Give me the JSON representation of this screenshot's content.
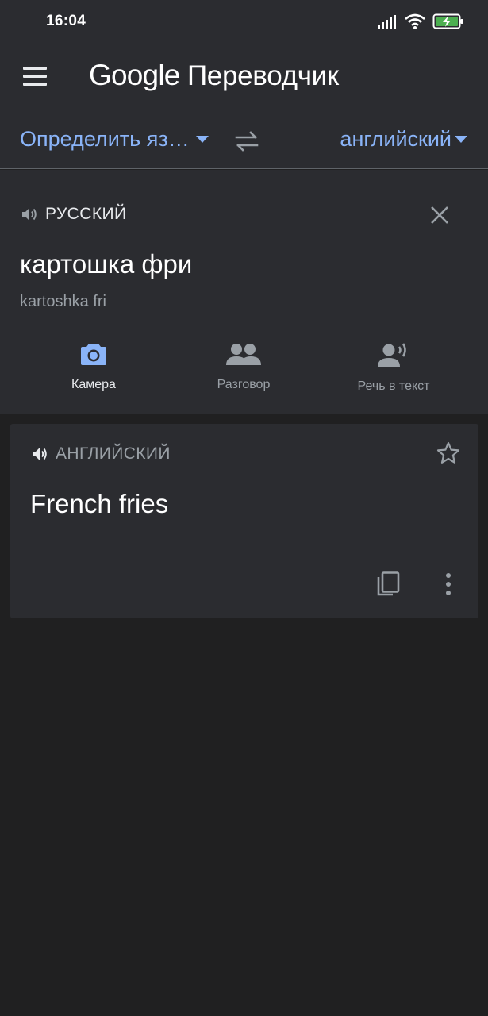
{
  "status_bar": {
    "time": "16:04",
    "icons": [
      "signal-icon",
      "wifi-icon",
      "battery-charging-icon"
    ]
  },
  "app_bar": {
    "menu_icon": "menu-icon",
    "title_brand": "Google",
    "title_product": "Переводчик"
  },
  "language_bar": {
    "source_language": "Определить яз…",
    "target_language": "английский",
    "swap_icon": "swap-icon"
  },
  "source": {
    "language_label": "РУССКИЙ",
    "text": "картошка фри",
    "transliteration": "kartoshka fri",
    "tools": [
      {
        "label": "Камера",
        "icon": "camera-icon",
        "active": true
      },
      {
        "label": "Разговор",
        "icon": "conversation-icon",
        "active": false
      },
      {
        "label": "Речь в текст",
        "icon": "speech-to-text-icon",
        "active": false
      }
    ]
  },
  "result": {
    "language_label": "АНГЛИЙСКИЙ",
    "text": "French fries",
    "actions": [
      "star-icon",
      "copy-icon",
      "more-icon"
    ]
  },
  "colors": {
    "accent": "#8ab4f8",
    "surface": "#2b2c30",
    "background": "#202021",
    "text_primary": "#ffffff",
    "text_secondary": "#9aa0a6",
    "battery_fill": "#4caf50"
  }
}
